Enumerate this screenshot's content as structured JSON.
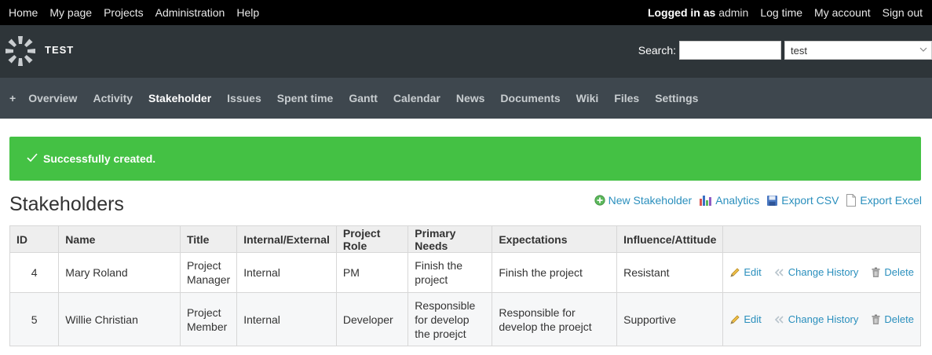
{
  "topbar": {
    "left_links": [
      "Home",
      "My page",
      "Projects",
      "Administration",
      "Help"
    ],
    "logged_in_prefix": "Logged in as",
    "logged_in_user": "admin",
    "right_links": [
      "Log time",
      "My account",
      "Sign out"
    ]
  },
  "header": {
    "project_name": "TEST",
    "search_label": "Search:",
    "search_value": "",
    "project_select_value": "test"
  },
  "main_menu": {
    "plus_label": "+",
    "items": [
      "Overview",
      "Activity",
      "Stakeholder",
      "Issues",
      "Spent time",
      "Gantt",
      "Calendar",
      "News",
      "Documents",
      "Wiki",
      "Files",
      "Settings"
    ],
    "selected": "Stakeholder"
  },
  "flash": {
    "message": "Successfully created."
  },
  "page": {
    "title": "Stakeholders",
    "actions": {
      "new": "New Stakeholder",
      "analytics": "Analytics",
      "export_csv": "Export CSV",
      "export_excel": "Export Excel"
    }
  },
  "table": {
    "headers": [
      "ID",
      "Name",
      "Title",
      "Internal/External",
      "Project Role",
      "Primary Needs",
      "Expectations",
      "Influence/Attitude",
      ""
    ],
    "rows": [
      {
        "id": "4",
        "name": "Mary Roland",
        "title": "Project Manager",
        "internal_external": "Internal",
        "project_role": "PM",
        "primary_needs": "Finish the project",
        "expectations": "Finish the project",
        "influence": "Resistant"
      },
      {
        "id": "5",
        "name": "Willie Christian",
        "title": "Project Member",
        "internal_external": "Internal",
        "project_role": "Developer",
        "primary_needs": "Responsible for develop the proejct",
        "expectations": "Responsible for develop the proejct",
        "influence": "Supportive"
      }
    ],
    "row_actions": {
      "edit": "Edit",
      "history": "Change History",
      "delete": "Delete"
    }
  },
  "colors": {
    "topbar_bg": "#000000",
    "header_bg": "#2e3539",
    "menu_bg": "#3e474e",
    "flash_bg": "#44c144",
    "link": "#2a8fbd"
  }
}
